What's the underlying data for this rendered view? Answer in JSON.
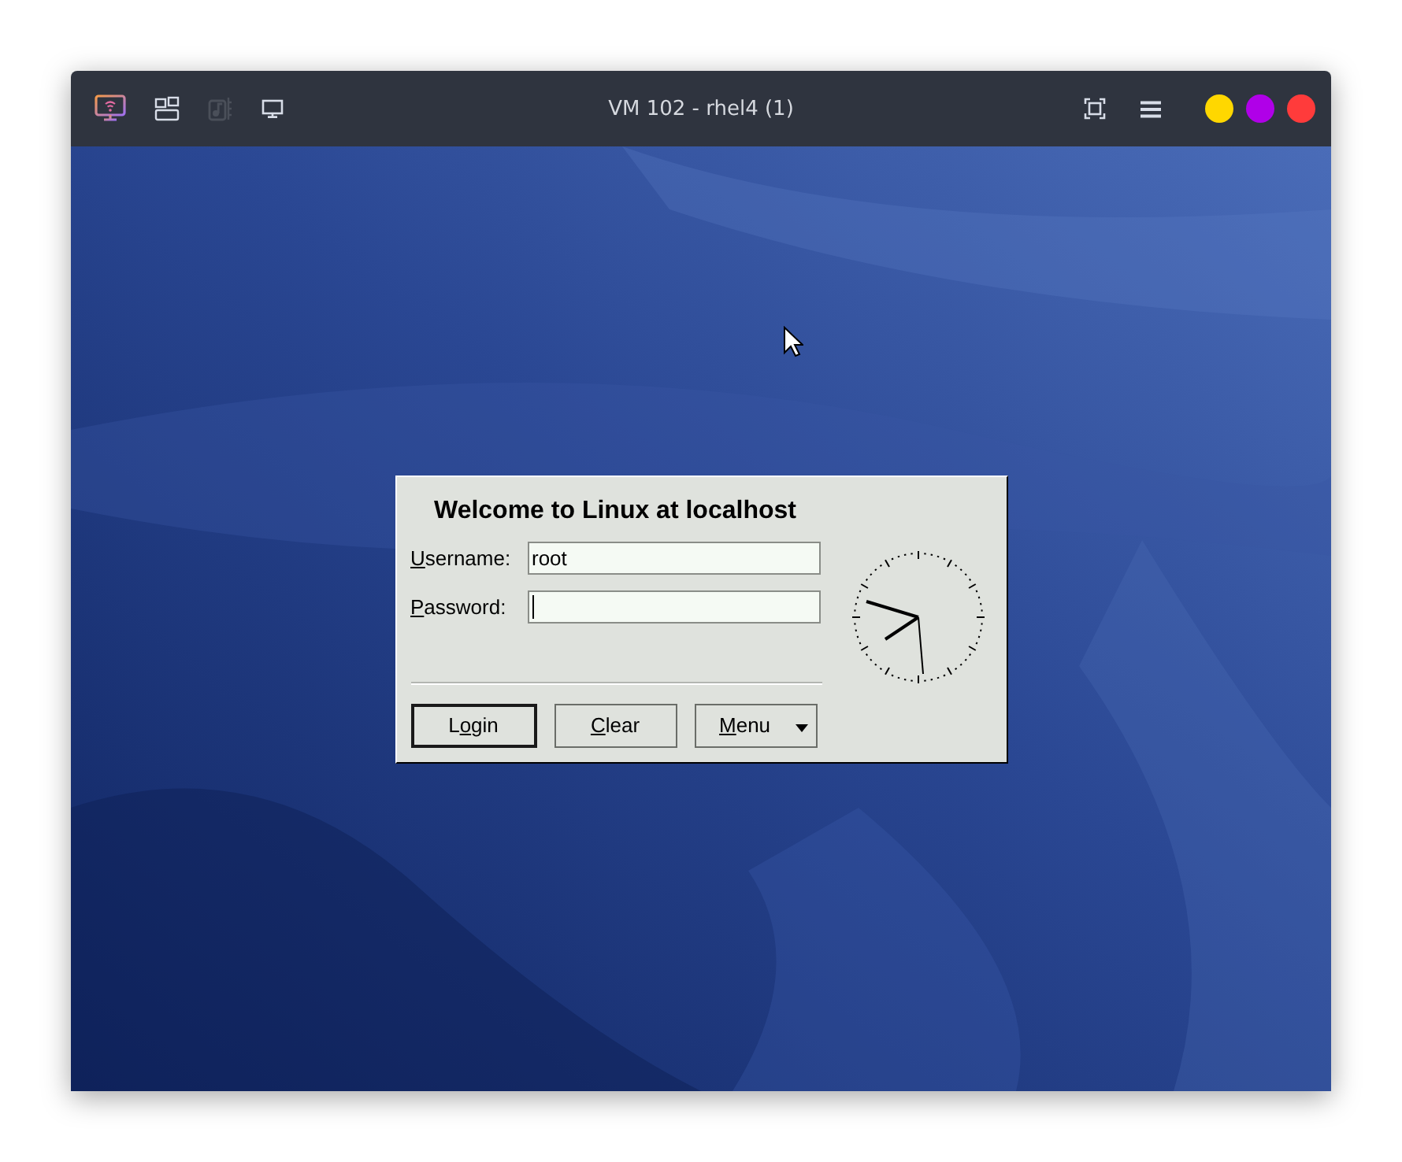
{
  "window": {
    "title": "VM 102 - rhel4 (1)"
  },
  "toolbar": [
    {
      "kind": "remote",
      "disabled": false
    },
    {
      "kind": "layout",
      "disabled": false
    },
    {
      "kind": "media",
      "disabled": true
    },
    {
      "kind": "display",
      "disabled": false
    }
  ],
  "window_buttons": [
    {
      "kind": "fullscreen"
    },
    {
      "kind": "menu"
    }
  ],
  "window_dots": [
    {
      "color": "#ffd700"
    },
    {
      "color": "#b000e8"
    },
    {
      "color": "#ff3b3b"
    }
  ],
  "login": {
    "title": "Welcome to Linux at localhost",
    "fields": [
      {
        "mnemonic": "U",
        "after": "sername:",
        "value": "root",
        "focused": false
      },
      {
        "mnemonic": "P",
        "after": "assword:",
        "focused": true
      }
    ],
    "buttons": [
      {
        "kind": "default",
        "before": "L",
        "mnemonic": "o",
        "after": "gin"
      },
      {
        "kind": "plain",
        "mnemonic": "C",
        "after": "lear"
      },
      {
        "kind": "dropdown",
        "mnemonic": "M",
        "after": "enu"
      }
    ]
  }
}
